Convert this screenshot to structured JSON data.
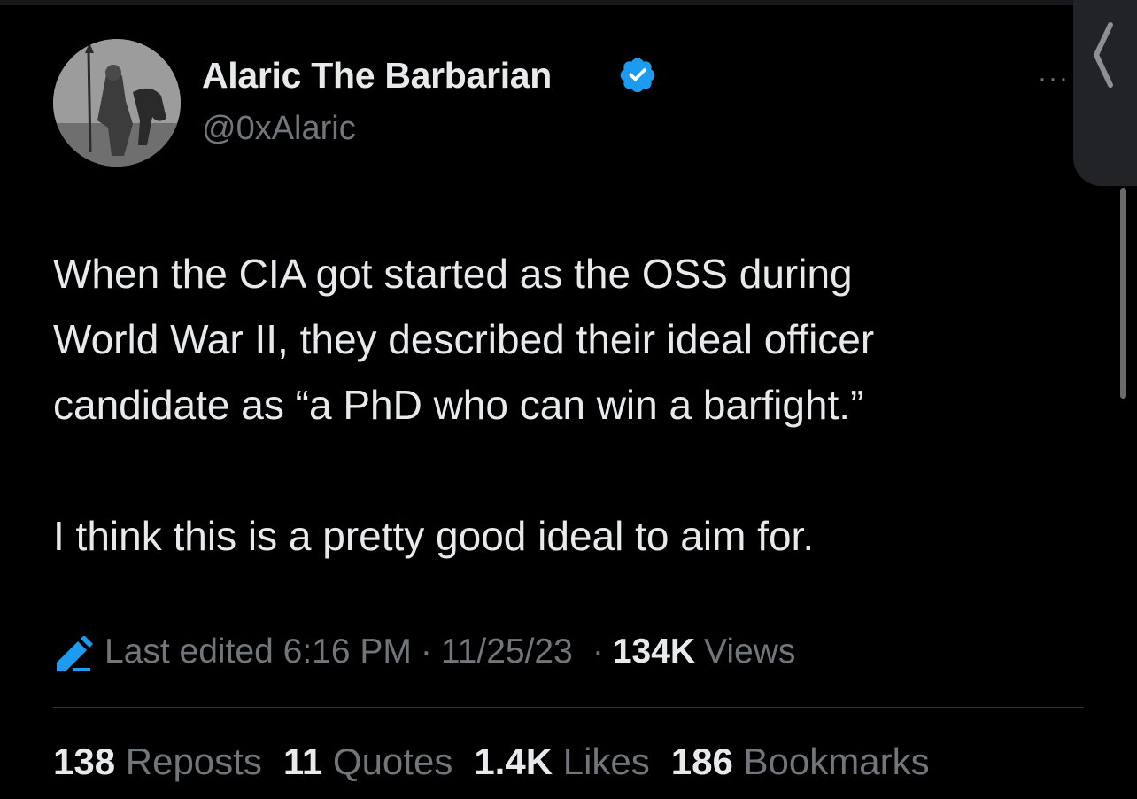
{
  "author": {
    "name": "Alaric The Barbarian",
    "handle": "@0xAlaric",
    "verified": true,
    "verified_color": "#1d9bf0",
    "avatar_icon": "barbarian-horseman-avatar"
  },
  "tweet": {
    "paragraph_1_line_1": "When the CIA got started as the OSS during",
    "paragraph_1_line_2": "World War II, they described their ideal officer",
    "paragraph_1_line_3": "candidate as “a PhD who can win a barfight.”",
    "paragraph_2": "I think this is a pretty good ideal to aim for."
  },
  "meta": {
    "edited_label": "Last edited 6:16 PM",
    "separator": "·",
    "date": "11/25/23",
    "views_count": "134K",
    "views_label": "Views",
    "edit_icon_color": "#1d9bf0"
  },
  "more_label": "···",
  "stats": {
    "reposts": {
      "count": "138",
      "label": "Reposts"
    },
    "quotes": {
      "count": "11",
      "label": "Quotes"
    },
    "likes": {
      "count": "1.4K",
      "label": "Likes"
    },
    "bookmarks": {
      "count": "186",
      "label": "Bookmarks"
    }
  },
  "colors": {
    "background": "#000000",
    "primary_text": "#e7e9ea",
    "secondary_text": "#71767b",
    "divider": "#2f3336",
    "accent": "#1d9bf0"
  }
}
